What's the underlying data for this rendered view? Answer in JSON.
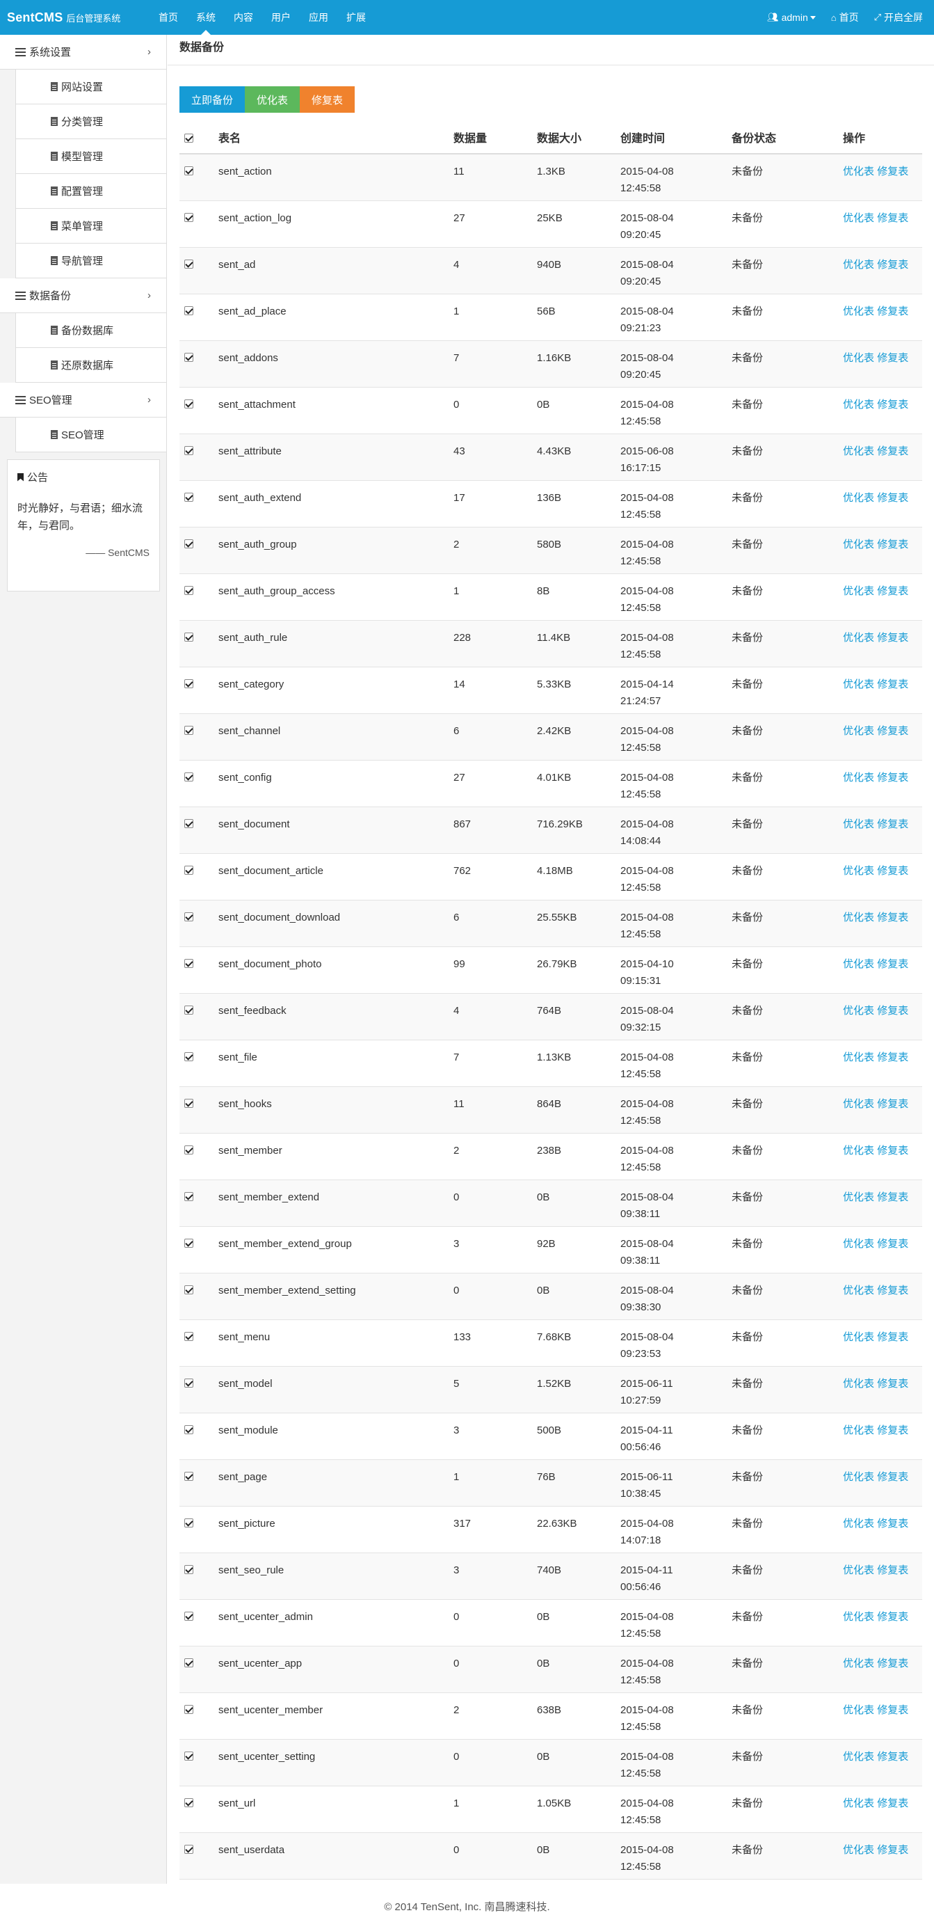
{
  "navbar": {
    "brand_main": "SentCMS",
    "brand_sub": "后台管理系统",
    "links": [
      "首页",
      "系统",
      "内容",
      "用户",
      "应用",
      "扩展"
    ],
    "active_index": 1,
    "user": "admin",
    "home": "首页",
    "fullscreen": "开启全屏"
  },
  "sidebar": {
    "groups": [
      {
        "title": "系统设置",
        "items": [
          "网站设置",
          "分类管理",
          "模型管理",
          "配置管理",
          "菜单管理",
          "导航管理"
        ]
      },
      {
        "title": "数据备份",
        "items": [
          "备份数据库",
          "还原数据库"
        ]
      },
      {
        "title": "SEO管理",
        "items": [
          "SEO管理"
        ]
      }
    ],
    "notice": {
      "title": "公告",
      "body": "时光静好，与君语；细水流年，与君同。",
      "sign": "—— SentCMS"
    }
  },
  "main": {
    "title": "数据备份",
    "buttons": {
      "backup": "立即备份",
      "optimize": "优化表",
      "repair": "修复表"
    },
    "columns": [
      "表名",
      "数据量",
      "数据大小",
      "创建时间",
      "备份状态",
      "操作"
    ],
    "row_actions": {
      "optimize": "优化表",
      "repair": "修复表"
    },
    "rows": [
      {
        "name": "sent_action",
        "count": "11",
        "size": "1.3KB",
        "date": "2015-04-08",
        "time": "12:45:58",
        "status": "未备份"
      },
      {
        "name": "sent_action_log",
        "count": "27",
        "size": "25KB",
        "date": "2015-08-04",
        "time": "09:20:45",
        "status": "未备份"
      },
      {
        "name": "sent_ad",
        "count": "4",
        "size": "940B",
        "date": "2015-08-04",
        "time": "09:20:45",
        "status": "未备份"
      },
      {
        "name": "sent_ad_place",
        "count": "1",
        "size": "56B",
        "date": "2015-08-04",
        "time": "09:21:23",
        "status": "未备份"
      },
      {
        "name": "sent_addons",
        "count": "7",
        "size": "1.16KB",
        "date": "2015-08-04",
        "time": "09:20:45",
        "status": "未备份"
      },
      {
        "name": "sent_attachment",
        "count": "0",
        "size": "0B",
        "date": "2015-04-08",
        "time": "12:45:58",
        "status": "未备份"
      },
      {
        "name": "sent_attribute",
        "count": "43",
        "size": "4.43KB",
        "date": "2015-06-08",
        "time": "16:17:15",
        "status": "未备份"
      },
      {
        "name": "sent_auth_extend",
        "count": "17",
        "size": "136B",
        "date": "2015-04-08",
        "time": "12:45:58",
        "status": "未备份"
      },
      {
        "name": "sent_auth_group",
        "count": "2",
        "size": "580B",
        "date": "2015-04-08",
        "time": "12:45:58",
        "status": "未备份"
      },
      {
        "name": "sent_auth_group_access",
        "count": "1",
        "size": "8B",
        "date": "2015-04-08",
        "time": "12:45:58",
        "status": "未备份"
      },
      {
        "name": "sent_auth_rule",
        "count": "228",
        "size": "11.4KB",
        "date": "2015-04-08",
        "time": "12:45:58",
        "status": "未备份"
      },
      {
        "name": "sent_category",
        "count": "14",
        "size": "5.33KB",
        "date": "2015-04-14",
        "time": "21:24:57",
        "status": "未备份"
      },
      {
        "name": "sent_channel",
        "count": "6",
        "size": "2.42KB",
        "date": "2015-04-08",
        "time": "12:45:58",
        "status": "未备份"
      },
      {
        "name": "sent_config",
        "count": "27",
        "size": "4.01KB",
        "date": "2015-04-08",
        "time": "12:45:58",
        "status": "未备份"
      },
      {
        "name": "sent_document",
        "count": "867",
        "size": "716.29KB",
        "date": "2015-04-08",
        "time": "14:08:44",
        "status": "未备份"
      },
      {
        "name": "sent_document_article",
        "count": "762",
        "size": "4.18MB",
        "date": "2015-04-08",
        "time": "12:45:58",
        "status": "未备份"
      },
      {
        "name": "sent_document_download",
        "count": "6",
        "size": "25.55KB",
        "date": "2015-04-08",
        "time": "12:45:58",
        "status": "未备份"
      },
      {
        "name": "sent_document_photo",
        "count": "99",
        "size": "26.79KB",
        "date": "2015-04-10",
        "time": "09:15:31",
        "status": "未备份"
      },
      {
        "name": "sent_feedback",
        "count": "4",
        "size": "764B",
        "date": "2015-08-04",
        "time": "09:32:15",
        "status": "未备份"
      },
      {
        "name": "sent_file",
        "count": "7",
        "size": "1.13KB",
        "date": "2015-04-08",
        "time": "12:45:58",
        "status": "未备份"
      },
      {
        "name": "sent_hooks",
        "count": "11",
        "size": "864B",
        "date": "2015-04-08",
        "time": "12:45:58",
        "status": "未备份"
      },
      {
        "name": "sent_member",
        "count": "2",
        "size": "238B",
        "date": "2015-04-08",
        "time": "12:45:58",
        "status": "未备份"
      },
      {
        "name": "sent_member_extend",
        "count": "0",
        "size": "0B",
        "date": "2015-08-04",
        "time": "09:38:11",
        "status": "未备份"
      },
      {
        "name": "sent_member_extend_group",
        "count": "3",
        "size": "92B",
        "date": "2015-08-04",
        "time": "09:38:11",
        "status": "未备份"
      },
      {
        "name": "sent_member_extend_setting",
        "count": "0",
        "size": "0B",
        "date": "2015-08-04",
        "time": "09:38:30",
        "status": "未备份"
      },
      {
        "name": "sent_menu",
        "count": "133",
        "size": "7.68KB",
        "date": "2015-08-04",
        "time": "09:23:53",
        "status": "未备份"
      },
      {
        "name": "sent_model",
        "count": "5",
        "size": "1.52KB",
        "date": "2015-06-11",
        "time": "10:27:59",
        "status": "未备份"
      },
      {
        "name": "sent_module",
        "count": "3",
        "size": "500B",
        "date": "2015-04-11",
        "time": "00:56:46",
        "status": "未备份"
      },
      {
        "name": "sent_page",
        "count": "1",
        "size": "76B",
        "date": "2015-06-11",
        "time": "10:38:45",
        "status": "未备份"
      },
      {
        "name": "sent_picture",
        "count": "317",
        "size": "22.63KB",
        "date": "2015-04-08",
        "time": "14:07:18",
        "status": "未备份"
      },
      {
        "name": "sent_seo_rule",
        "count": "3",
        "size": "740B",
        "date": "2015-04-11",
        "time": "00:56:46",
        "status": "未备份"
      },
      {
        "name": "sent_ucenter_admin",
        "count": "0",
        "size": "0B",
        "date": "2015-04-08",
        "time": "12:45:58",
        "status": "未备份"
      },
      {
        "name": "sent_ucenter_app",
        "count": "0",
        "size": "0B",
        "date": "2015-04-08",
        "time": "12:45:58",
        "status": "未备份"
      },
      {
        "name": "sent_ucenter_member",
        "count": "2",
        "size": "638B",
        "date": "2015-04-08",
        "time": "12:45:58",
        "status": "未备份"
      },
      {
        "name": "sent_ucenter_setting",
        "count": "0",
        "size": "0B",
        "date": "2015-04-08",
        "time": "12:45:58",
        "status": "未备份"
      },
      {
        "name": "sent_url",
        "count": "1",
        "size": "1.05KB",
        "date": "2015-04-08",
        "time": "12:45:58",
        "status": "未备份"
      },
      {
        "name": "sent_userdata",
        "count": "0",
        "size": "0B",
        "date": "2015-04-08",
        "time": "12:45:58",
        "status": "未备份"
      }
    ]
  },
  "footer": {
    "text": "© 2014 TenSent, Inc. 南昌腾速科技."
  },
  "colors": {
    "primary": "#169bd5",
    "success": "#5cb85c",
    "warning": "#f0822d"
  }
}
